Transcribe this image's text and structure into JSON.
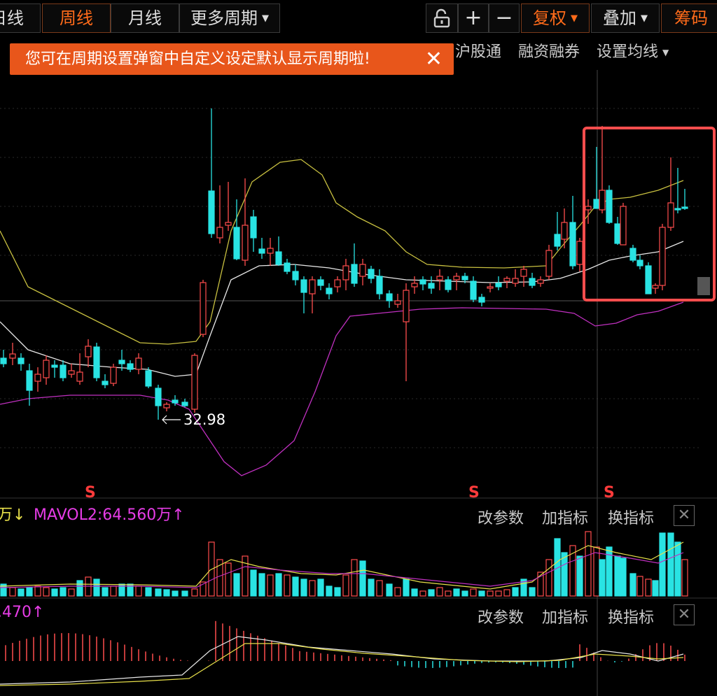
{
  "toolbar": {
    "periods": [
      "日线",
      "周线",
      "月线",
      "更多周期"
    ],
    "active_period": "周线",
    "unlock_icon": "unlock-icon",
    "zoom_in_label": "+",
    "zoom_out_label": "−",
    "rights_label": "复权",
    "overlay_label": "叠加",
    "chips_label": "筹码",
    "accent": "#ff6b1a"
  },
  "toast": {
    "message": "您可在周期设置弹窗中自定义设定默认显示周期啦!",
    "close_label": "✕"
  },
  "sub_links": [
    "沪股通",
    "融资融券",
    "设置均线"
  ],
  "main_chart": {
    "low_marker": "32.98",
    "signal_label": "S",
    "up_color": "#ff4d4d",
    "down_color": "#29e3e3"
  },
  "volume_panel": {
    "legend_a": "万↓",
    "legend_b": "MAVOL2:64.560万↑",
    "buttons": [
      "改参数",
      "加指标",
      "换指标"
    ],
    "close_label": "✕"
  },
  "macd_panel": {
    "legend": ".470↑",
    "buttons": [
      "改参数",
      "加指标",
      "换指标"
    ],
    "close_label": "✕"
  },
  "highlight": {
    "color": "#ff4d4d"
  }
}
